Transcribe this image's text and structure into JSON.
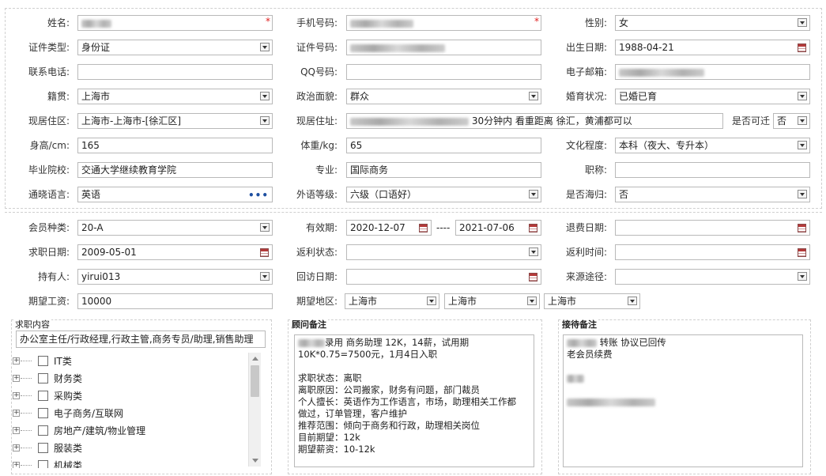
{
  "personal": {
    "name": {
      "label": "姓名:",
      "required": "*"
    },
    "mobile": {
      "label": "手机号码:",
      "required": "*"
    },
    "gender": {
      "label": "性别:",
      "value": "女"
    },
    "id_type": {
      "label": "证件类型:",
      "value": "身份证"
    },
    "id_no": {
      "label": "证件号码:"
    },
    "birth": {
      "label": "出生日期:",
      "value": "1988-04-21"
    },
    "phone": {
      "label": "联系电话:"
    },
    "qq": {
      "label": "QQ号码:"
    },
    "email": {
      "label": "电子邮箱:"
    },
    "native": {
      "label": "籍贯:",
      "value": "上海市"
    },
    "political": {
      "label": "政治面貌:",
      "value": "群众"
    },
    "marital": {
      "label": "婚育状况:",
      "value": "已婚已育"
    },
    "residence": {
      "label": "现居住区:",
      "value": "上海市-上海市-[徐汇区]"
    },
    "address": {
      "label": "现居住址:",
      "value": "30分钟内 看重距离  徐汇，黄浦都可以"
    },
    "relocate": {
      "label": "是否可迁",
      "value": "否"
    },
    "height": {
      "label": "身高/cm:",
      "value": "165"
    },
    "weight": {
      "label": "体重/kg:",
      "value": "65"
    },
    "education": {
      "label": "文化程度:",
      "value": "本科（夜大、专升本）"
    },
    "school": {
      "label": "毕业院校:",
      "value": "交通大学继续教育学院"
    },
    "major": {
      "label": "专业:",
      "value": "国际商务"
    },
    "title": {
      "label": "职称:"
    },
    "language": {
      "label": "通晓语言:",
      "value": "英语",
      "more": "•••"
    },
    "level": {
      "label": "外语等级:",
      "value": "六级（口语好）"
    },
    "returnee": {
      "label": "是否海归:",
      "value": "否"
    }
  },
  "member": {
    "type": {
      "label": "会员种类:",
      "value": "20-A"
    },
    "valid": {
      "label": "有效期:",
      "from": "2020-12-07",
      "sep": "----",
      "to": "2021-07-06"
    },
    "refund_date": {
      "label": "退费日期:"
    },
    "job_date": {
      "label": "求职日期:",
      "value": "2009-05-01"
    },
    "rebate_status": {
      "label": "返利状态:"
    },
    "rebate_time": {
      "label": "返利时间:"
    },
    "holder": {
      "label": "持有人:",
      "value": "yirui013"
    },
    "visit_date": {
      "label": "回访日期:"
    },
    "source": {
      "label": "来源途径:"
    },
    "salary": {
      "label": "期望工资:",
      "value": "10000"
    },
    "region": {
      "label": "期望地区:",
      "v1": "上海市",
      "v2": "上海市",
      "v3": "上海市"
    }
  },
  "job_content": {
    "title": "求职内容",
    "summary": "办公室主任/行政经理,行政主管,商务专员/助理,销售助理",
    "tree": [
      "IT类",
      "财务类",
      "采购类",
      "电子商务/互联网",
      "房地产/建筑/物业管理",
      "服装类",
      "机械类"
    ]
  },
  "consultant": {
    "title": "顾问备注",
    "lines": [
      "录用 商务助理 12K，14薪，试用期",
      "10K*0.75=7500元，1月4日入职",
      "",
      "求职状态：离职",
      "离职原因：公司搬家，财务有问题，部门裁员",
      "个人擅长：英语作为工作语言，市场，助理相关工作都",
      "做过，订单管理，客户维护",
      "推荐范围：倾向于商务和行政，助理相关岗位",
      "目前期望：12k",
      "期望薪资：10-12k"
    ]
  },
  "reception": {
    "title": "接待备注",
    "line1": "转账  协议已回传",
    "line2": "老会员续费"
  }
}
